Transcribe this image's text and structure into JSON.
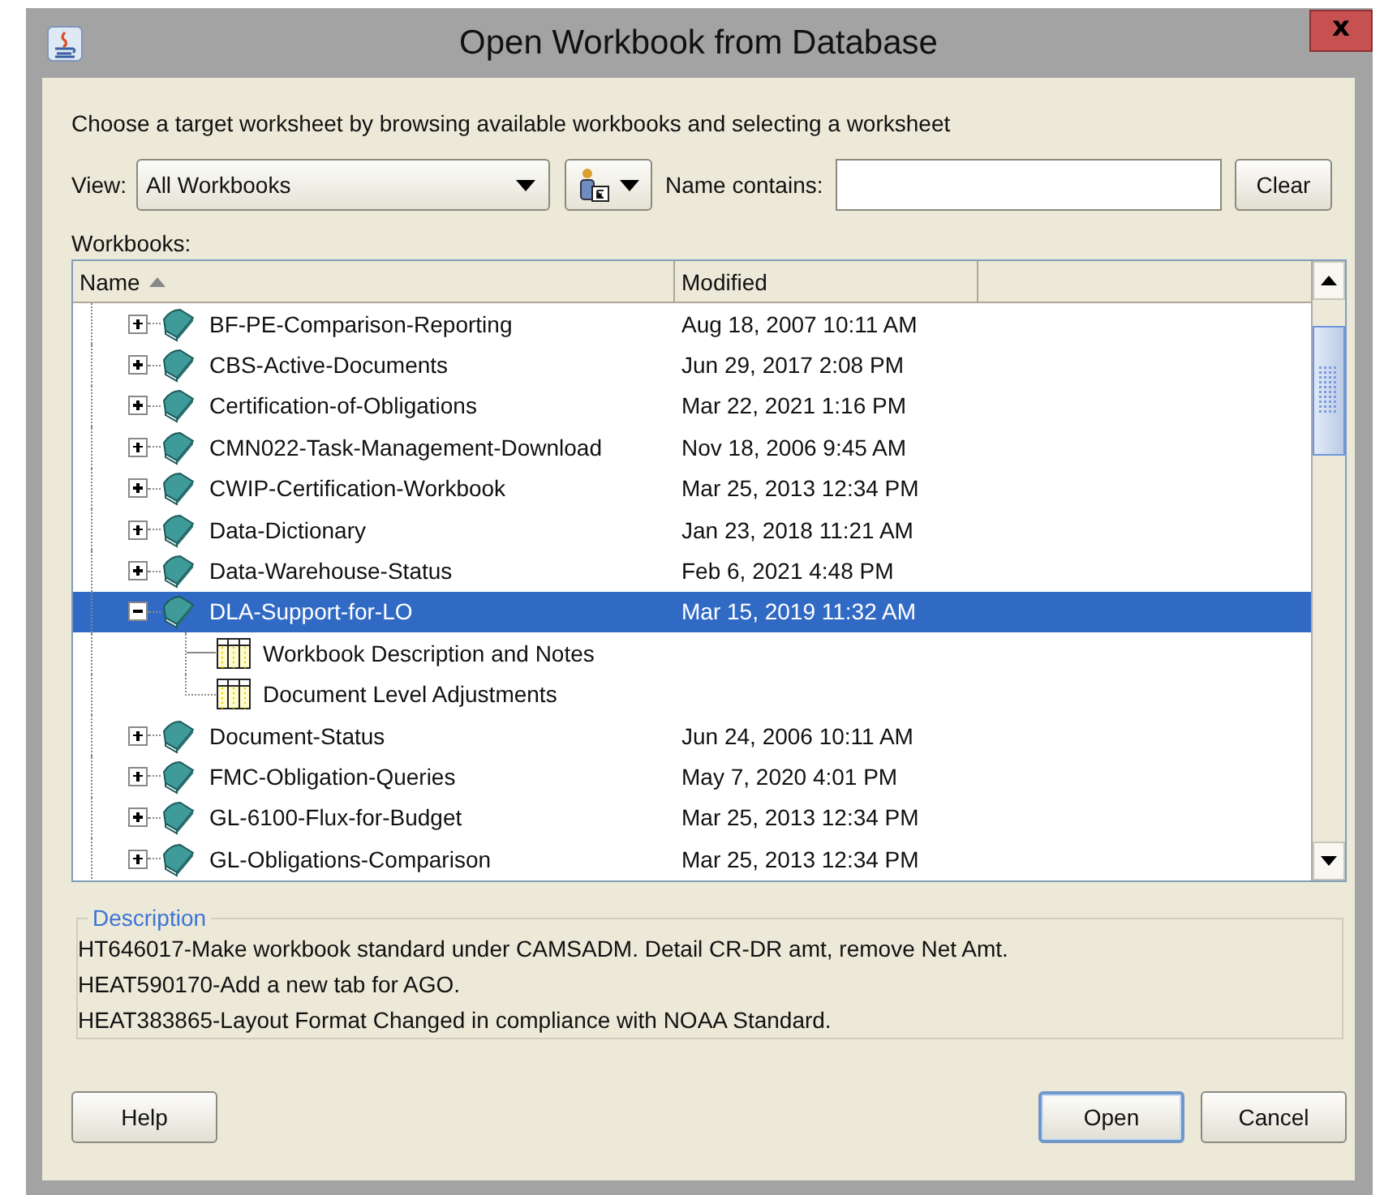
{
  "window": {
    "title": "Open Workbook from Database",
    "close": "x"
  },
  "instruction": "Choose a target worksheet by browsing available workbooks and selecting a worksheet",
  "view": {
    "label": "View:",
    "value": "All Workbooks"
  },
  "filter": {
    "label": "Name contains:"
  },
  "clear_button": "Clear",
  "workbooks": {
    "label": "Workbooks:",
    "columns": [
      {
        "label": "Name",
        "sorted": true
      },
      {
        "label": "Modified",
        "sorted": false
      }
    ],
    "rows": [
      {
        "name": "BF-PE-Comparison-Reporting",
        "modified": "Aug 18, 2007 10:11 AM",
        "expanded": false,
        "selected": false
      },
      {
        "name": "CBS-Active-Documents",
        "modified": "Jun 29, 2017 2:08 PM",
        "expanded": false,
        "selected": false
      },
      {
        "name": "Certification-of-Obligations",
        "modified": "Mar 22, 2021 1:16 PM",
        "expanded": false,
        "selected": false
      },
      {
        "name": "CMN022-Task-Management-Download",
        "modified": "Nov 18, 2006 9:45 AM",
        "expanded": false,
        "selected": false
      },
      {
        "name": "CWIP-Certification-Workbook",
        "modified": "Mar 25, 2013 12:34 PM",
        "expanded": false,
        "selected": false
      },
      {
        "name": "Data-Dictionary",
        "modified": "Jan 23, 2018 11:21 AM",
        "expanded": false,
        "selected": false
      },
      {
        "name": "Data-Warehouse-Status",
        "modified": "Feb 6, 2021 4:48 PM",
        "expanded": false,
        "selected": false
      },
      {
        "name": "DLA-Support-for-LO",
        "modified": "Mar 15, 2019 11:32 AM",
        "expanded": true,
        "selected": true,
        "children": [
          {
            "name": "Workbook Description and Notes"
          },
          {
            "name": "Document Level Adjustments"
          }
        ]
      },
      {
        "name": "Document-Status",
        "modified": "Jun 24, 2006 10:11 AM",
        "expanded": false,
        "selected": false
      },
      {
        "name": "FMC-Obligation-Queries",
        "modified": "May 7, 2020 4:01 PM",
        "expanded": false,
        "selected": false
      },
      {
        "name": "GL-6100-Flux-for-Budget",
        "modified": "Mar 25, 2013 12:34 PM",
        "expanded": false,
        "selected": false
      },
      {
        "name": "GL-Obligations-Comparison",
        "modified": "Mar 25, 2013 12:34 PM",
        "expanded": false,
        "selected": false
      }
    ]
  },
  "description": {
    "legend": "Description",
    "lines": [
      "HT646017-Make workbook standard under CAMSADM. Detail CR-DR amt, remove Net Amt.",
      "HEAT590170-Add a new tab for AGO.",
      "HEAT383865-Layout Format Changed in compliance with NOAA Standard."
    ]
  },
  "left_buttons": [
    {
      "label": "Help",
      "default": false
    }
  ],
  "right_buttons": [
    {
      "label": "Open",
      "default": true
    },
    {
      "label": "Cancel",
      "default": false
    }
  ]
}
